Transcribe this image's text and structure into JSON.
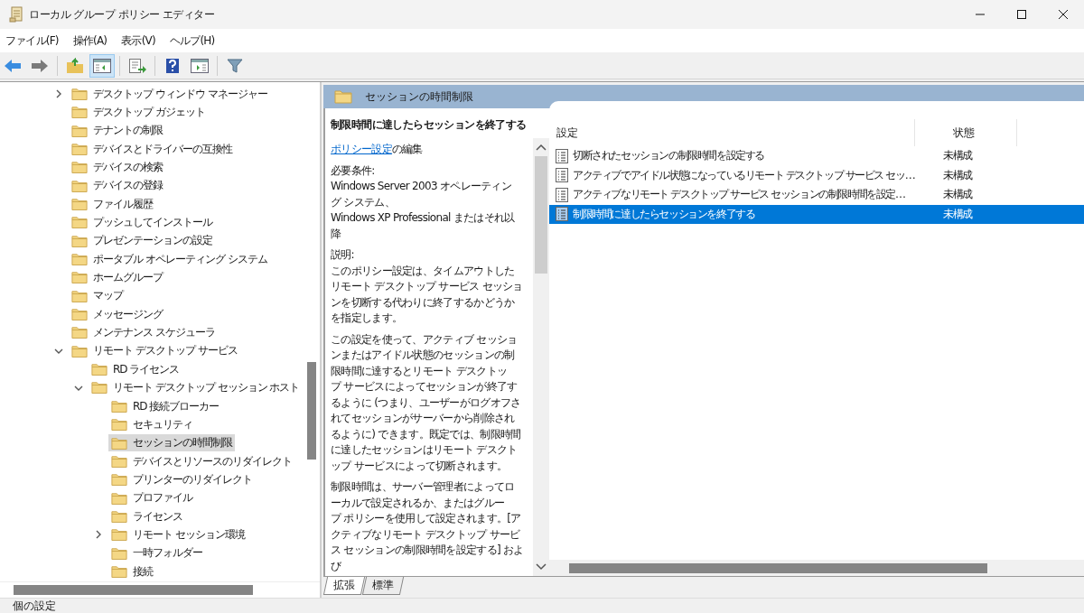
{
  "window": {
    "title": "ローカル グループ ポリシー エディター"
  },
  "menu": [
    "ファイル(F)",
    "操作(A)",
    "表示(V)",
    "ヘルプ(H)"
  ],
  "toolbar": [
    {
      "kind": "back",
      "pressed": false
    },
    {
      "kind": "forward",
      "pressed": false
    },
    {
      "kind": "sep"
    },
    {
      "kind": "up",
      "pressed": false
    },
    {
      "kind": "tree",
      "pressed": true
    },
    {
      "kind": "sep"
    },
    {
      "kind": "export",
      "pressed": false
    },
    {
      "kind": "sep"
    },
    {
      "kind": "help",
      "pressed": false
    },
    {
      "kind": "pane",
      "pressed": false
    },
    {
      "kind": "sep"
    },
    {
      "kind": "filter",
      "pressed": false
    }
  ],
  "tree": [
    {
      "label": "デスクトップ ウィンドウ マネージャー",
      "expanded": false,
      "selected": false
    },
    {
      "label": "デスクトップ ガジェット",
      "selected": false
    },
    {
      "label": "テナントの制限",
      "selected": false
    },
    {
      "label": "デバイスとドライバーの互換性",
      "selected": false
    },
    {
      "label": "デバイスの検索",
      "selected": false
    },
    {
      "label": "デバイスの登録",
      "selected": false
    },
    {
      "label": "ファイル履歴",
      "selected": false
    },
    {
      "label": "プッシュしてインストール",
      "selected": false
    },
    {
      "label": "プレゼンテーションの設定",
      "selected": false
    },
    {
      "label": "ポータブル オペレーティング システム",
      "selected": false
    },
    {
      "label": "ホームグループ",
      "selected": false
    },
    {
      "label": "マップ",
      "selected": false
    },
    {
      "label": "メッセージング",
      "selected": false
    },
    {
      "label": "メンテナンス スケジューラ",
      "selected": false
    },
    {
      "label": "リモート デスクトップ サービス",
      "expanded": true,
      "selected": false,
      "children": [
        {
          "label": "RD ライセンス",
          "selected": false
        },
        {
          "label": "リモート デスクトップ セッション ホスト",
          "expanded": true,
          "selected": false,
          "children": [
            {
              "label": "RD 接続ブローカー",
              "selected": false
            },
            {
              "label": "セキュリティ",
              "selected": false
            },
            {
              "label": "セッションの時間制限",
              "selected": true
            },
            {
              "label": "デバイスとリソースのリダイレクト",
              "selected": false
            },
            {
              "label": "プリンターのリダイレクト",
              "selected": false
            },
            {
              "label": "プロファイル",
              "selected": false
            },
            {
              "label": "ライセンス",
              "selected": false
            },
            {
              "label": "リモート セッション環境",
              "expanded": false,
              "selected": false
            },
            {
              "label": "一時フォルダー",
              "selected": false
            },
            {
              "label": "接続",
              "selected": false
            }
          ]
        }
      ]
    }
  ],
  "pane": {
    "header": "セッションの時間制限",
    "description": {
      "title": "制限時間に達したらセッションを終了する",
      "edit_link": "ポリシー設定",
      "edit_suffix": "の編集",
      "blocks": [
        {
          "label": "必要条件:",
          "text": "Windows Server 2003 オペレーティング システム、Windows XP Professional またはそれ以降"
        },
        {
          "label": "説明:",
          "text": "このポリシー設定は、タイムアウトしたリモート デスクトップ サービス セッションを切断する代わりに終了するかどうかを指定します。"
        },
        {
          "text": "この設定を使って、アクティブ セッションまたはアイドル状態のセッションの制限時間に達するとリモート デスクトップ サービスによってセッションが終了するように (つまり、ユーザーがログオフされてセッションがサーバーから削除されるように) できます。既定では、制限時間に達したセッションはリモート デスクトップ サービスによって切断されます。"
        },
        {
          "text": "制限時間は、サーバー管理者によってローカルで設定されるか、またはグループ ポリシーを使用して設定されます。[アクティブなリモート デスクトップ サービス セッションの制限時間を設定する] および"
        }
      ]
    },
    "columns": [
      "設定",
      "状態"
    ],
    "rows": [
      {
        "setting": "切断されたセッションの制限時間を設定する",
        "state": "未構成",
        "selected": false
      },
      {
        "setting": "アクティブでアイドル状態になっているリモート デスクトップ サービス セッ…",
        "state": "未構成",
        "selected": false
      },
      {
        "setting": "アクティブなリモート デスクトップ サービス セッションの制限時間を設定…",
        "state": "未構成",
        "selected": false
      },
      {
        "setting": "制限時間に達したらセッションを終了する",
        "state": "未構成",
        "selected": true
      }
    ],
    "tabs": [
      {
        "label": "拡張",
        "selected": true
      },
      {
        "label": "標準",
        "selected": false
      }
    ]
  },
  "status_bar": "個の設定"
}
